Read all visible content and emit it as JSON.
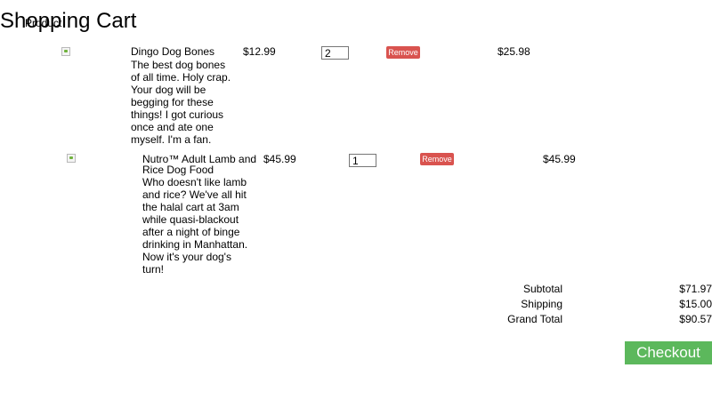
{
  "cart": {
    "title": "Shopping Cart",
    "column_header": "Product"
  },
  "items": [
    {
      "name": "Dingo Dog Bones",
      "description": "The best dog bones of all time. Holy crap. Your dog will be begging for these things! I got curious once and ate one myself. I'm a fan.",
      "price": "$12.99",
      "quantity": "2",
      "remove_label": "Remove",
      "line_total": "$25.98"
    },
    {
      "name": "Nutro™ Adult Lamb and Rice Dog Food",
      "description": "Who doesn't like lamb and rice? We've all hit the halal cart at 3am while quasi-blackout after a night of binge drinking in Manhattan. Now it's your dog's turn!",
      "price": "$45.99",
      "quantity": "1",
      "remove_label": "Remove",
      "line_total": "$45.99"
    }
  ],
  "totals": {
    "subtotal_label": "Subtotal",
    "subtotal_value": "$71.97",
    "shipping_label": "Shipping",
    "shipping_value": "$15.00",
    "grand_total_label": "Grand Total",
    "grand_total_value": "$90.57"
  },
  "checkout_label": "Checkout",
  "colors": {
    "remove_button": "#d9534f",
    "checkout_button": "#5cb85c"
  }
}
